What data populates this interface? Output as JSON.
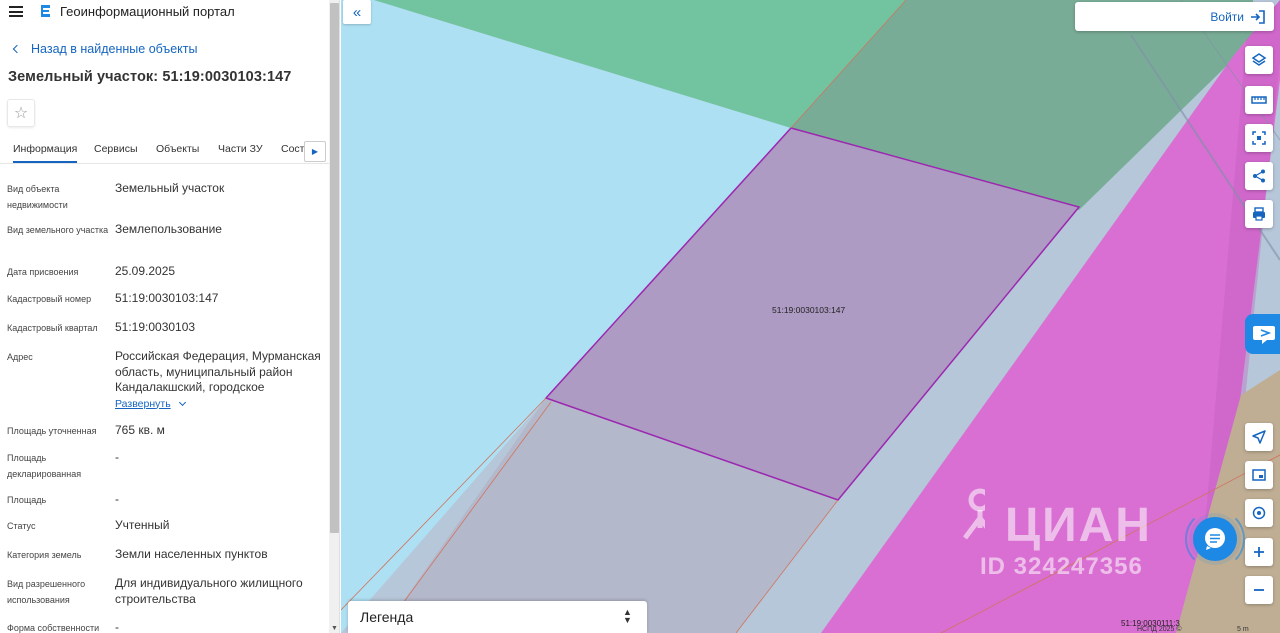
{
  "header": {
    "app_title": "Геоинформационный портал",
    "back_link": "Назад в найденные объекты",
    "object_title": "Земельный участок: 51:19:0030103:147"
  },
  "tabs": [
    {
      "label": "Информация",
      "active": true
    },
    {
      "label": "Сервисы",
      "active": false
    },
    {
      "label": "Объекты",
      "active": false
    },
    {
      "label": "Части ЗУ",
      "active": false
    },
    {
      "label": "Соста",
      "active": false
    }
  ],
  "attributes": [
    {
      "key": "Вид объекта недвижимости",
      "value": "Земельный участок"
    },
    {
      "key": "Вид земельного участка",
      "value": "Землепользование"
    },
    {
      "key": "Дата присвоения",
      "value": "25.09.2025"
    },
    {
      "key": "Кадастровый номер",
      "value": "51:19:0030103:147"
    },
    {
      "key": "Кадастровый квартал",
      "value": "51:19:0030103"
    },
    {
      "key": "Адрес",
      "value": "Российская Федерация, Мурманская область, муниципальный район Кандалакшский, городское",
      "expand_label": "Развернуть"
    },
    {
      "key": "Площадь уточненная",
      "value": "765 кв. м"
    },
    {
      "key": "Площадь декларированная",
      "value": "-"
    },
    {
      "key": "Площадь",
      "value": "-"
    },
    {
      "key": "Статус",
      "value": "Учтенный"
    },
    {
      "key": "Категория земель",
      "value": "Земли населенных пунктов"
    },
    {
      "key": "Вид разрешенного использования",
      "value": "Для индивидуального жилищного строительства"
    },
    {
      "key": "Форма собственности",
      "value": "-"
    }
  ],
  "map": {
    "login_label": "Войти",
    "parcel_label": "51:19:0030103:147",
    "corner_label": "51:19:0030111:3",
    "legend_label": "Легенда",
    "watermark_brand": "ЦИАН",
    "watermark_id": "ID 324247356",
    "scale_text": "НСПД 2025 ©",
    "scale_unit": "5 m",
    "tools_top": [
      "layers-icon",
      "ruler-icon",
      "select-area-icon",
      "share-icon",
      "print-icon"
    ],
    "tools_bottom": [
      "locate-icon",
      "minimap-icon",
      "geocode-icon",
      "zoom-in-icon",
      "zoom-out-icon"
    ],
    "colors": {
      "water": "#aee0f3",
      "green_zone": "#72c4a0",
      "parcel": "#ad9bc3",
      "road": "#d96fd2",
      "accent": "#1565c0",
      "chat": "#1e88e5"
    }
  }
}
